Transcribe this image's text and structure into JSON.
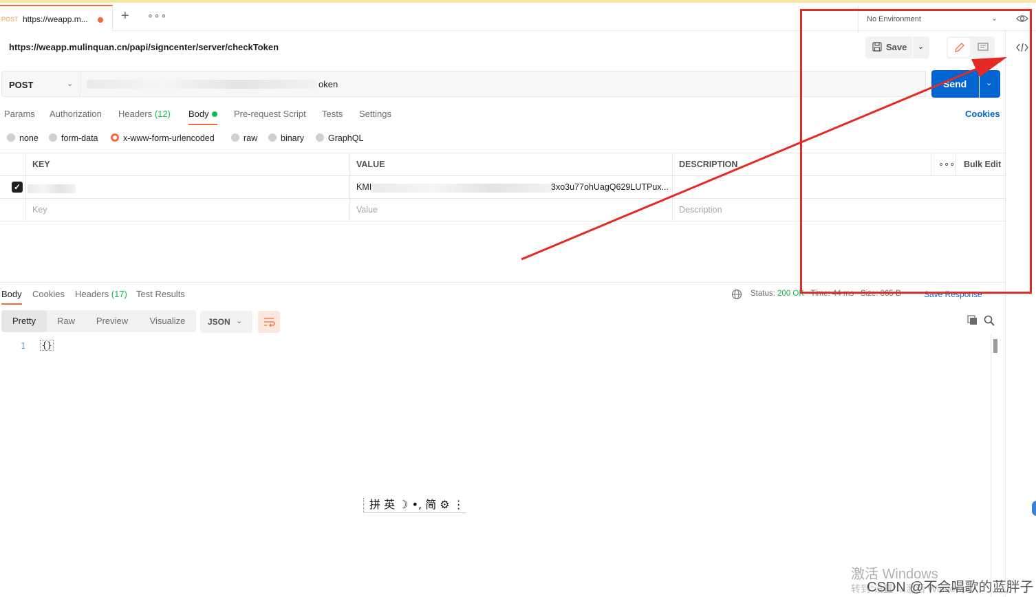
{
  "tab": {
    "method": "POST",
    "name": "https://weapp.m..."
  },
  "environment": {
    "label": "No Environment"
  },
  "request": {
    "url_title": "https://weapp.mulinquan.cn/papi/signcenter/server/checkToken",
    "method": "POST",
    "url_value": "https://weapp.mulinquan.cn/papi/signcenter/server/checkToken",
    "url_visible_fragment": "oken",
    "save_label": "Save",
    "send_label": "Send"
  },
  "req_tabs": [
    {
      "label": "Params"
    },
    {
      "label": "Authorization"
    },
    {
      "label": "Headers",
      "count": "(12)"
    },
    {
      "label": "Body"
    },
    {
      "label": "Pre-request Script"
    },
    {
      "label": "Tests"
    },
    {
      "label": "Settings"
    }
  ],
  "cookies_label": "Cookies",
  "body_types": [
    "none",
    "form-data",
    "x-www-form-urlencoded",
    "raw",
    "binary",
    "GraphQL"
  ],
  "body_type_selected": "x-www-form-urlencoded",
  "params_table": {
    "headers": [
      "KEY",
      "VALUE",
      "DESCRIPTION"
    ],
    "bulk_edit": "Bulk Edit",
    "rows": [
      {
        "checked": true,
        "key": "",
        "value_prefix": "KMI",
        "value_suffix": "3xo3u77ohUagQ629LUTPux...",
        "description": ""
      }
    ],
    "placeholders": {
      "key": "Key",
      "value": "Value",
      "description": "Description"
    }
  },
  "response": {
    "tabs": [
      {
        "label": "Body"
      },
      {
        "label": "Cookies"
      },
      {
        "label": "Headers",
        "count": "(17)"
      },
      {
        "label": "Test Results"
      }
    ],
    "status_label": "Status:",
    "status_value": "200 OK",
    "time_text": "Time: 44 ms",
    "size_text": "Size: 865 B",
    "save_response": "Save Response",
    "views": [
      "Pretty",
      "Raw",
      "Preview",
      "Visualize"
    ],
    "format": "JSON",
    "line_number": "1",
    "code": "{}"
  },
  "ime_toolbar": "拼 英 ☽ •, 简 ⚙ ⋮",
  "overlay": {
    "watermark": "激活 Windows",
    "watermark_sub": "转到\"设置\"以激活 Windows。",
    "credit": "CSDN @不会唱歌的蓝胖子"
  },
  "colors": {
    "accent": "#f26b3a",
    "send": "#0265d2",
    "success": "#0cbb52",
    "annotation": "#e32b23"
  }
}
